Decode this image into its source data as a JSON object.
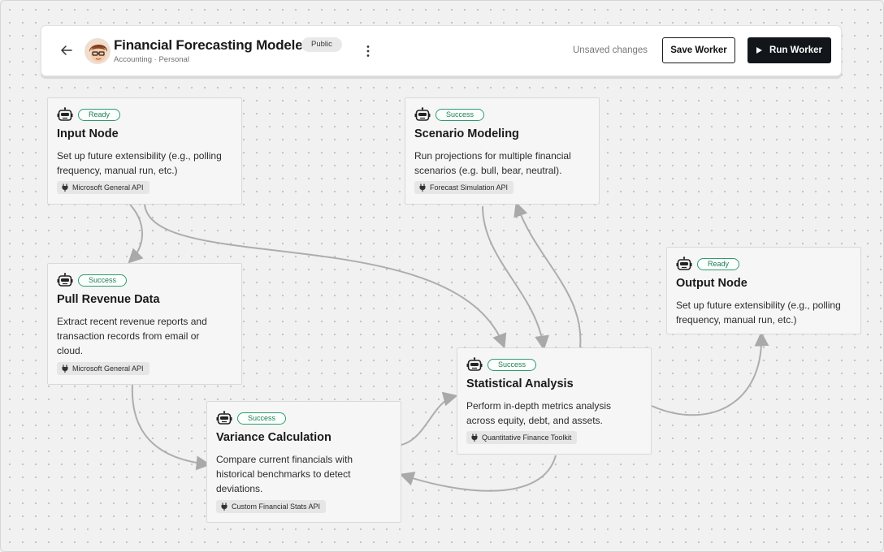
{
  "header": {
    "title": "Financial Forecasting Modeler",
    "subtitle": "Accounting · Personal",
    "visibility": "Public",
    "unsaved": "Unsaved changes",
    "save_label": "Save Worker",
    "run_label": "Run Worker"
  },
  "colors": {
    "accent_green": "#2f9b6d",
    "run_button_bg": "#12161b",
    "canvas_bg": "#f1f1f1"
  },
  "nodes": [
    {
      "title": "Input Node",
      "status": "Ready",
      "desc_lines": [
        "Set up future extensibility (e.g., polling",
        "frequency, manual run, etc.)"
      ],
      "api": "Microsoft General API"
    },
    {
      "title": "Scenario Modeling",
      "status": "Success",
      "desc_lines": [
        "Run projections for multiple financial",
        "scenarios (e.g. bull, bear, neutral)."
      ],
      "api": "Forecast Simulation API"
    },
    {
      "title": "Pull Revenue Data",
      "status": "Success",
      "desc_lines": [
        "Extract recent revenue reports and",
        "transaction records from email or",
        "cloud."
      ],
      "api": "Microsoft General API"
    },
    {
      "title": "Output Node",
      "status": "Ready",
      "desc_lines": [
        "Set up future extensibility (e.g., polling",
        "frequency, manual run, etc.)"
      ],
      "api": ""
    },
    {
      "title": "Statistical Analysis",
      "status": "Success",
      "desc_lines": [
        "Perform in-depth metrics analysis",
        "across equity, debt, and assets."
      ],
      "api": "Quantitative Finance Toolkit"
    },
    {
      "title": "Variance Calculation",
      "status": "Success",
      "desc_lines": [
        "Compare current financials with",
        "historical benchmarks to detect",
        "deviations."
      ],
      "api": "Custom Financial Stats API"
    }
  ]
}
